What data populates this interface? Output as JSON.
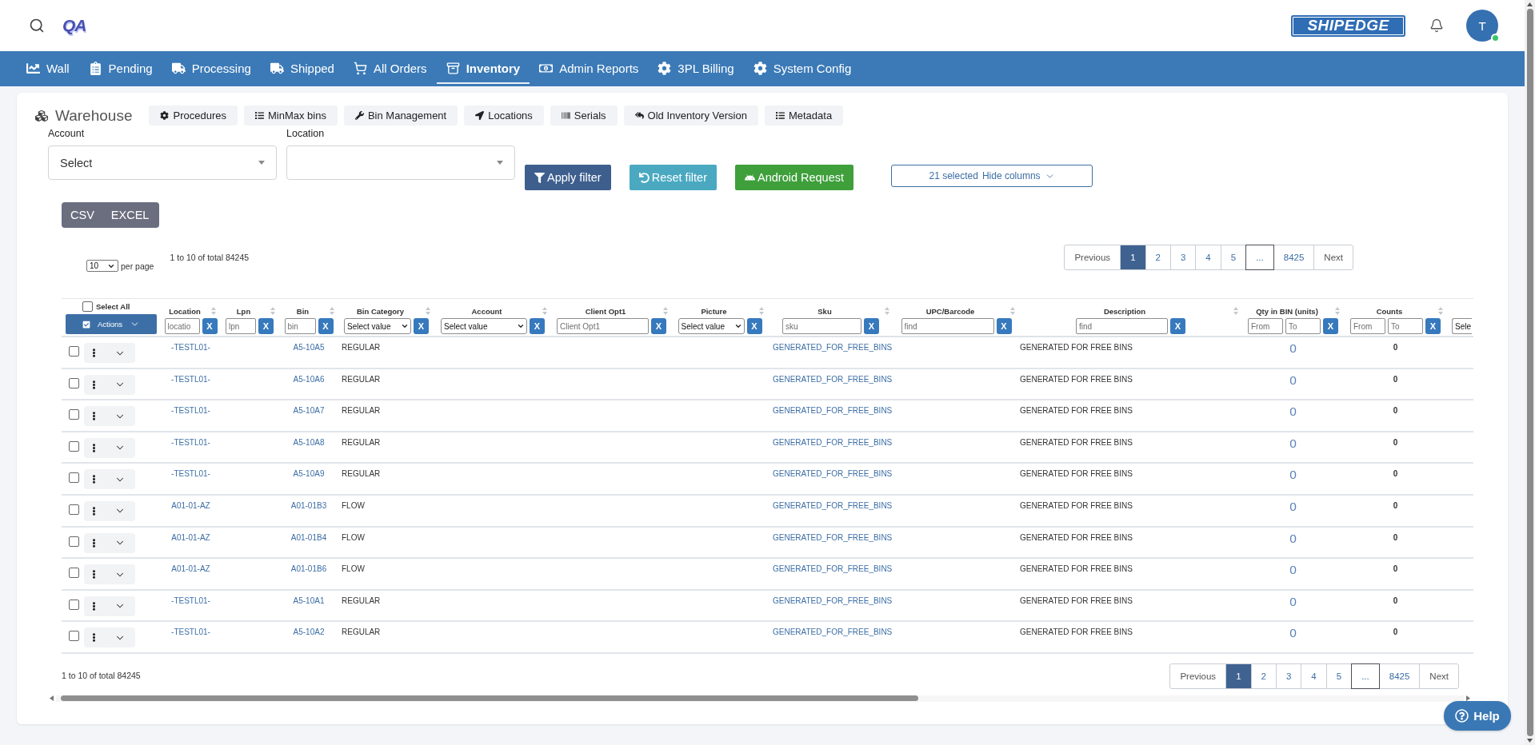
{
  "header": {
    "logo": "QA",
    "brand": "SHIPEDGE",
    "avatar": {
      "initial": "T",
      "online": true
    }
  },
  "nav": [
    {
      "label": "Wall",
      "selected": false
    },
    {
      "label": "Pending",
      "selected": false
    },
    {
      "label": "Processing",
      "selected": false
    },
    {
      "label": "Shipped",
      "selected": false
    },
    {
      "label": "All Orders",
      "selected": false
    },
    {
      "label": "Inventory",
      "selected": true
    },
    {
      "label": "Admin Reports",
      "selected": false
    },
    {
      "label": "3PL Billing",
      "selected": false
    },
    {
      "label": "System Config",
      "selected": false
    }
  ],
  "toolbar": {
    "title": "Warehouse",
    "buttons": [
      "Procedures",
      "MinMax bins",
      "Bin Management",
      "Locations",
      "Serials",
      "Old Inventory Version",
      "Metadata"
    ]
  },
  "filters": {
    "fields": [
      {
        "label": "Account",
        "value": "Select"
      },
      {
        "label": "Location"
      }
    ],
    "actions": [
      {
        "label": "Apply filter",
        "kind": "primary"
      },
      {
        "label": "Reset filter",
        "kind": "info"
      },
      {
        "label": "Android Request",
        "kind": "success"
      }
    ],
    "column_picker": {
      "count": "21 selected",
      "label": "Hide columns"
    }
  },
  "export": [
    "CSV",
    "EXCEL"
  ],
  "top_bar": {
    "per_page": {
      "value": "10",
      "label": "per page"
    },
    "summary": "1 to 10 of total 84245",
    "pagination": [
      {
        "label": "Previous",
        "kind": "nav",
        "selected": false
      },
      {
        "label": "1",
        "kind": "page",
        "selected": true
      },
      {
        "label": "2",
        "kind": "page",
        "selected": false
      },
      {
        "label": "3",
        "kind": "page",
        "selected": false
      },
      {
        "label": "4",
        "kind": "page",
        "selected": false
      },
      {
        "label": "5",
        "kind": "page",
        "selected": false
      },
      {
        "label": "...",
        "kind": "ellipsis",
        "selected": false
      },
      {
        "label": "8425",
        "kind": "page",
        "selected": false
      },
      {
        "label": "Next",
        "kind": "nav",
        "selected": false
      }
    ]
  },
  "table": {
    "select_all": {
      "label": "Select All",
      "checked": false
    },
    "actions": "Actions",
    "columns": [
      {
        "label": "Location",
        "filter": {
          "kind": "text",
          "placeholder": "locatio",
          "clear": "X"
        }
      },
      {
        "label": "Lpn",
        "filter": {
          "kind": "text",
          "placeholder": "lpn",
          "clear": "X"
        }
      },
      {
        "label": "Bin",
        "filter": {
          "kind": "text",
          "placeholder": "bin",
          "clear": "X"
        }
      },
      {
        "label": "Bin Category",
        "filter": {
          "kind": "select",
          "value": "Select value",
          "clear": "X"
        }
      },
      {
        "label": "Account",
        "filter": {
          "kind": "select",
          "value": "Select value",
          "clear": "X"
        }
      },
      {
        "label": "Client Opt1",
        "filter": {
          "kind": "text",
          "placeholder": "Client Opt1",
          "clear": "X"
        }
      },
      {
        "label": "Picture",
        "filter": {
          "kind": "select",
          "value": "Select value",
          "clear": "X"
        }
      },
      {
        "label": "Sku",
        "filter": {
          "kind": "text",
          "placeholder": "sku",
          "clear": "X"
        }
      },
      {
        "label": "UPC/Barcode",
        "filter": {
          "kind": "text",
          "placeholder": "find",
          "clear": "X"
        }
      },
      {
        "label": "Description",
        "filter": {
          "kind": "text",
          "placeholder": "find",
          "clear": "X"
        }
      },
      {
        "label": "Qty in BIN (units)",
        "filter": {
          "kind": "range",
          "inputs": [
            {
              "placeholder": "From"
            },
            {
              "placeholder": "To"
            }
          ],
          "clear": "X"
        }
      },
      {
        "label": "Counts",
        "filter": {
          "kind": "range",
          "inputs": [
            {
              "placeholder": "From"
            },
            {
              "placeholder": "To"
            }
          ],
          "clear": "X"
        }
      },
      {
        "filter": {
          "kind": "select",
          "value": "Sele"
        }
      }
    ],
    "rows": [
      {
        "checked": false,
        "location": "-TESTL01-",
        "bin": "A5-10A5",
        "bin_category": "REGULAR",
        "sku": "GENERATED_FOR_FREE_BINS",
        "description": "GENERATED FOR FREE BINS",
        "qty": "0",
        "counts": "0"
      },
      {
        "checked": false,
        "location": "-TESTL01-",
        "bin": "A5-10A6",
        "bin_category": "REGULAR",
        "sku": "GENERATED_FOR_FREE_BINS",
        "description": "GENERATED FOR FREE BINS",
        "qty": "0",
        "counts": "0"
      },
      {
        "checked": false,
        "location": "-TESTL01-",
        "bin": "A5-10A7",
        "bin_category": "REGULAR",
        "sku": "GENERATED_FOR_FREE_BINS",
        "description": "GENERATED FOR FREE BINS",
        "qty": "0",
        "counts": "0"
      },
      {
        "checked": false,
        "location": "-TESTL01-",
        "bin": "A5-10A8",
        "bin_category": "REGULAR",
        "sku": "GENERATED_FOR_FREE_BINS",
        "description": "GENERATED FOR FREE BINS",
        "qty": "0",
        "counts": "0"
      },
      {
        "checked": false,
        "location": "-TESTL01-",
        "bin": "A5-10A9",
        "bin_category": "REGULAR",
        "sku": "GENERATED_FOR_FREE_BINS",
        "description": "GENERATED FOR FREE BINS",
        "qty": "0",
        "counts": "0"
      },
      {
        "checked": false,
        "location": "A01-01-AZ",
        "bin": "A01-01B3",
        "bin_category": "FLOW",
        "sku": "GENERATED_FOR_FREE_BINS",
        "description": "GENERATED FOR FREE BINS",
        "qty": "0",
        "counts": "0"
      },
      {
        "checked": false,
        "location": "A01-01-AZ",
        "bin": "A01-01B4",
        "bin_category": "FLOW",
        "sku": "GENERATED_FOR_FREE_BINS",
        "description": "GENERATED FOR FREE BINS",
        "qty": "0",
        "counts": "0"
      },
      {
        "checked": false,
        "location": "A01-01-AZ",
        "bin": "A01-01B6",
        "bin_category": "FLOW",
        "sku": "GENERATED_FOR_FREE_BINS",
        "description": "GENERATED FOR FREE BINS",
        "qty": "0",
        "counts": "0"
      },
      {
        "checked": false,
        "location": "-TESTL01-",
        "bin": "A5-10A1",
        "bin_category": "REGULAR",
        "sku": "GENERATED_FOR_FREE_BINS",
        "description": "GENERATED FOR FREE BINS",
        "qty": "0",
        "counts": "0"
      },
      {
        "checked": false,
        "location": "-TESTL01-",
        "bin": "A5-10A2",
        "bin_category": "REGULAR",
        "sku": "GENERATED_FOR_FREE_BINS",
        "description": "GENERATED FOR FREE BINS",
        "qty": "0",
        "counts": "0"
      }
    ]
  },
  "bottom_bar": {
    "summary": "1 to 10 of total 84245",
    "pagination": [
      {
        "label": "Previous",
        "kind": "nav",
        "selected": false
      },
      {
        "label": "1",
        "kind": "page",
        "selected": true
      },
      {
        "label": "2",
        "kind": "page",
        "selected": false
      },
      {
        "label": "3",
        "kind": "page",
        "selected": false
      },
      {
        "label": "4",
        "kind": "page",
        "selected": false
      },
      {
        "label": "5",
        "kind": "page",
        "selected": false
      },
      {
        "label": "...",
        "kind": "ellipsis",
        "selected": false
      },
      {
        "label": "8425",
        "kind": "page",
        "selected": false
      },
      {
        "label": "Next",
        "kind": "nav",
        "selected": false
      }
    ]
  },
  "help": "Help"
}
